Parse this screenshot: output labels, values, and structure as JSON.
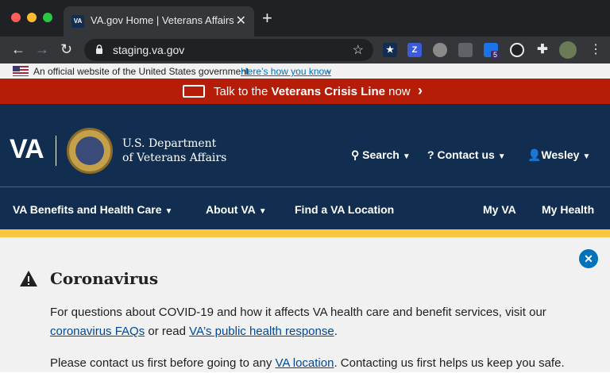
{
  "browser": {
    "tab_title": "VA.gov Home | Veterans Affairs",
    "tab_favicon_text": "VA",
    "new_tab": "+",
    "tab_close": "✕",
    "url": "staging.va.gov",
    "extension_icons": [
      "shield-extension-icon",
      "zoom-extension-icon",
      "circle-extension-icon",
      "copy-extension-icon",
      "ghost-extension-icon",
      "eye-extension-icon",
      "puzzle-extension-icon"
    ],
    "extension_z": "Z",
    "extension_badge": "5"
  },
  "gov_banner": {
    "text": "An official website of the United States government",
    "link": "Here’s how you know"
  },
  "crisis": {
    "prefix": "Talk to the ",
    "bold": "Veterans Crisis Line",
    "suffix": " now"
  },
  "header": {
    "logo": "VA",
    "dept_line1": "U.S. Department",
    "dept_line2": "of Veterans Affairs",
    "search": "Search",
    "contact": "Contact us",
    "user": "Wesley"
  },
  "nav": {
    "benefits": "VA Benefits and Health Care",
    "about": "About VA",
    "find": "Find a VA Location",
    "myva": "My VA",
    "myhealth": "My Health"
  },
  "alert": {
    "title": "Coronavirus",
    "p1_text": "For questions about COVID-19 and how it affects VA health care and benefit services, visit our",
    "p1_link1": "coronavirus FAQs",
    "p1_mid": " or read ",
    "p1_link2": "VA’s public health response",
    "p1_end": ".",
    "p2_text": "Please contact us first before going to any ",
    "p2_link": "VA location",
    "p2_end": ". Contacting us first helps us keep you safe."
  },
  "colors": {
    "crisis_red": "#b51d09",
    "va_navy": "#112e51",
    "gold": "#f9c642",
    "link_blue": "#004795"
  }
}
